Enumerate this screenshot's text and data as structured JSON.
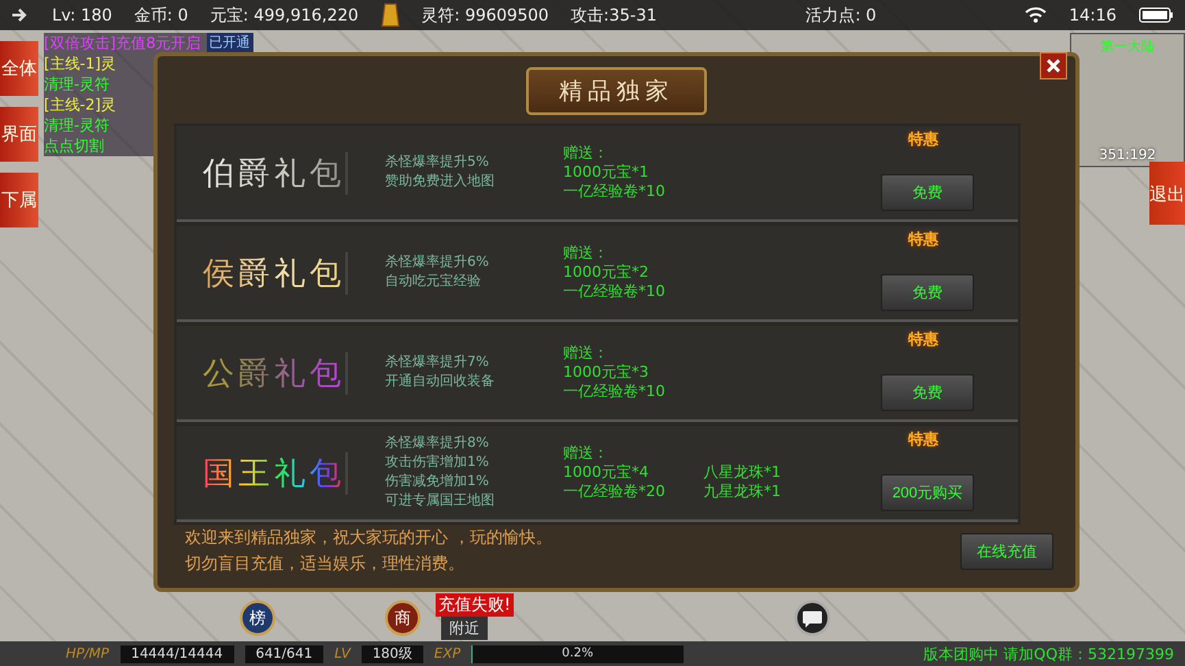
{
  "status_bar": {
    "level": "Lv: 180",
    "gold": "金币: 0",
    "yuanbao": "元宝: 499,916,220",
    "lingfu": "灵符: 99609500",
    "attack": "攻击:35-31",
    "vitality": "活力点: 0",
    "time": "14:16"
  },
  "left_tabs": [
    {
      "label": "全体"
    },
    {
      "label": "界面"
    },
    {
      "label": "下属"
    }
  ],
  "quests": [
    {
      "text": "[双倍攻击]充值8元开启",
      "kind": "event",
      "badge": "已开通"
    },
    {
      "text": "[主线-1]灵",
      "kind": "main"
    },
    {
      "text": "清理-灵符",
      "kind": "task"
    },
    {
      "text": "[主线-2]灵",
      "kind": "main"
    },
    {
      "text": "清理-灵符",
      "kind": "task"
    },
    {
      "text": "点点切割",
      "kind": "task"
    }
  ],
  "minimap": {
    "region": "第一大陆",
    "coords": "351:192"
  },
  "exit_button": "退出",
  "dialog": {
    "title": "精品独家",
    "packages": [
      {
        "name": "伯爵礼包",
        "kind": "silver",
        "perks": [
          "杀怪爆率提升5%",
          "赞助免费进入地图"
        ],
        "gift_label": "赠送：",
        "gifts": [
          [
            "1000元宝*1",
            "一亿经验卷*10"
          ]
        ],
        "badge": "特惠",
        "button": "免费"
      },
      {
        "name": "侯爵礼包",
        "kind": "gold",
        "perks": [
          "杀怪爆率提升6%",
          "自动吃元宝经验"
        ],
        "gift_label": "赠送：",
        "gifts": [
          [
            "1000元宝*2",
            "一亿经验卷*10"
          ]
        ],
        "badge": "特惠",
        "button": "免费"
      },
      {
        "name": "公爵礼包",
        "kind": "purple",
        "perks": [
          "杀怪爆率提升7%",
          "开通自动回收装备"
        ],
        "gift_label": "赠送：",
        "gifts": [
          [
            "1000元宝*3",
            "一亿经验卷*10"
          ]
        ],
        "badge": "特惠",
        "button": "免费"
      },
      {
        "name": "国王礼包",
        "kind": "rainbow",
        "perks": [
          "杀怪爆率提升8%",
          "攻击伤害增加1%",
          "伤害减免增加1%",
          "可进专属国王地图"
        ],
        "gift_label": "赠送：",
        "gifts": [
          [
            "1000元宝*4",
            "一亿经验卷*20"
          ],
          [
            "八星龙珠*1",
            "九星龙珠*1"
          ]
        ],
        "badge": "特惠",
        "button": "200元购买"
      }
    ],
    "notes": [
      "欢迎来到精品独家，祝大家玩的开心 ，玩的愉快。",
      "切勿盲目充值，适当娱乐，理性消费。"
    ],
    "recharge_button": "在线充值"
  },
  "hud_buttons": [
    {
      "label": "榜",
      "kind": "blue"
    },
    {
      "label": "商",
      "kind": "red"
    }
  ],
  "alert": "充值失败!",
  "nearby_tab": "附近",
  "bottom_bar": {
    "hp_label": "HP/MP",
    "hp": "14444/14444",
    "mp": "641/641",
    "lv_label": "LV",
    "lv": "180级",
    "exp_label": "EXP",
    "exp": "0.2%",
    "level": 0.002,
    "notice": "版本团购中 请加QQ群：532197399"
  }
}
